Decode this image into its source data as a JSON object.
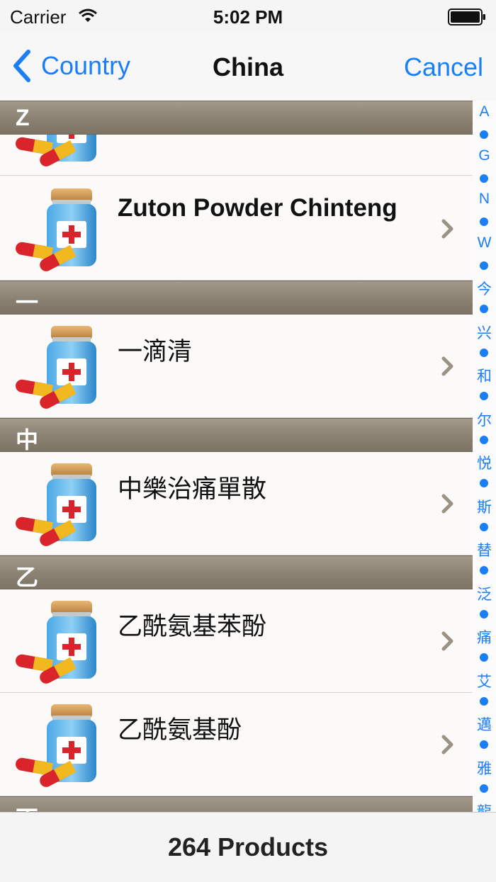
{
  "status_bar": {
    "carrier": "Carrier",
    "time": "5:02 PM"
  },
  "nav": {
    "back_label": "Country",
    "title": "China",
    "cancel_label": "Cancel"
  },
  "sections": [
    {
      "title": "Z"
    },
    {
      "title": "一"
    },
    {
      "title": "中"
    },
    {
      "title": "乙"
    },
    {
      "title": "丁"
    }
  ],
  "rows": [
    {
      "title": ""
    },
    {
      "title": "Zuton Powder Chinteng"
    },
    {
      "title": "一滴清"
    },
    {
      "title": "中樂治痛單散"
    },
    {
      "title": "乙酰氨基苯酚"
    },
    {
      "title": "乙酰氨基酚"
    }
  ],
  "index": [
    "A",
    "G",
    "N",
    "W",
    "今",
    "兴",
    "和",
    "尔",
    "悦",
    "斯",
    "替",
    "泛",
    "痛",
    "艾",
    "邁",
    "雅",
    "龍"
  ],
  "footer": {
    "label": "264 Products"
  },
  "colors": {
    "accent": "#1a7ef6",
    "section_header": "#8b8172"
  },
  "icons": {
    "row_icon": "medicine-bottle-pills-icon",
    "row_accessory": "chevron-right-icon"
  }
}
